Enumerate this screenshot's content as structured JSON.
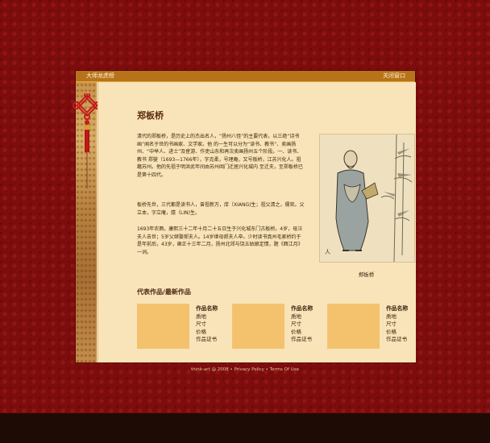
{
  "window": {
    "title": "大师龙虎榜",
    "close_label": "关闭窗口"
  },
  "artist": {
    "name": "郑板桥",
    "bio": [
      "清代的郑板桥，是历史上的杰出名人，“扬州八怪”的主要代表，以三绝“诗书画”闻名于世的书画家、文学家。他 的一生可以分为“读书、教书”、卖画扬州、“中举人、进士”及宦游、作吏山东和再次卖画扬州五个阶段。一、读书、教书 郑燮（1693—1766年），字克柔，号理庵，又号板桥，江苏兴化人。祖籍苏州。他的先祖于明洪武年间由苏州阊门迁居兴化城内 至迁夫，至郑板桥已是第十四代。",
      "板桥先世，三代都是读书人，曾祖新万，庠（XIANG)生；祖父清之，儒官。父立本，字立庵，廪（LIN)生。",
      "1693年农酉，康熙三十二年十月二十五日生于兴化城东门古板桥。4岁，母汪夫人去世；5岁父继娶郝夫人。14岁继母郝夫人卒。少时读书真州毛家桥约于是年前后，43岁，雍正十三年二月，扬州北郊与饶五姑娘定情，题《酉江月》一词。"
    ],
    "portrait_caption": "郑板桥"
  },
  "works_section": {
    "heading": "代表作品/最新作品",
    "items": [
      {
        "name": "作品名称",
        "fields": [
          "质地",
          "尺寸",
          "价格",
          "作品证书"
        ]
      },
      {
        "name": "作品名称",
        "fields": [
          "质地",
          "尺寸",
          "价格",
          "作品证书"
        ]
      },
      {
        "name": "作品名称",
        "fields": [
          "质地",
          "尺寸",
          "价格",
          "作品证书"
        ]
      }
    ]
  },
  "footer": {
    "copyright": "think-art @ 2008",
    "privacy": "Privacy Policy",
    "terms": "Terms Of Use",
    "separator": "•"
  },
  "colors": {
    "page_bg": "#7d0d0d",
    "panel_bg": "#f7e2b6",
    "titlebar": "#b8731a",
    "thumb": "#f4c26c",
    "bottom_bar": "#1f0b05"
  },
  "icons": {
    "decoration": "chinese-knot-icon"
  }
}
